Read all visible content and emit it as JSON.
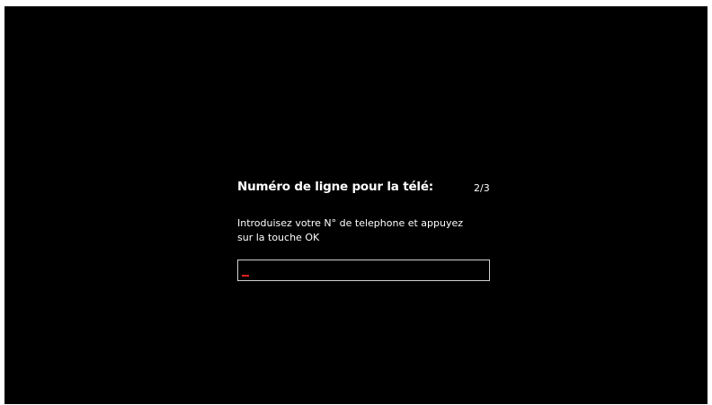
{
  "dialog": {
    "title": "Numéro de ligne pour la télé:",
    "step": "2/3",
    "instructions_line1": "Introduisez votre N° de telephone et appuyez",
    "instructions_line2": "sur la touche OK"
  },
  "phone_input": {
    "value": "",
    "cursor_color": "#e02020"
  }
}
